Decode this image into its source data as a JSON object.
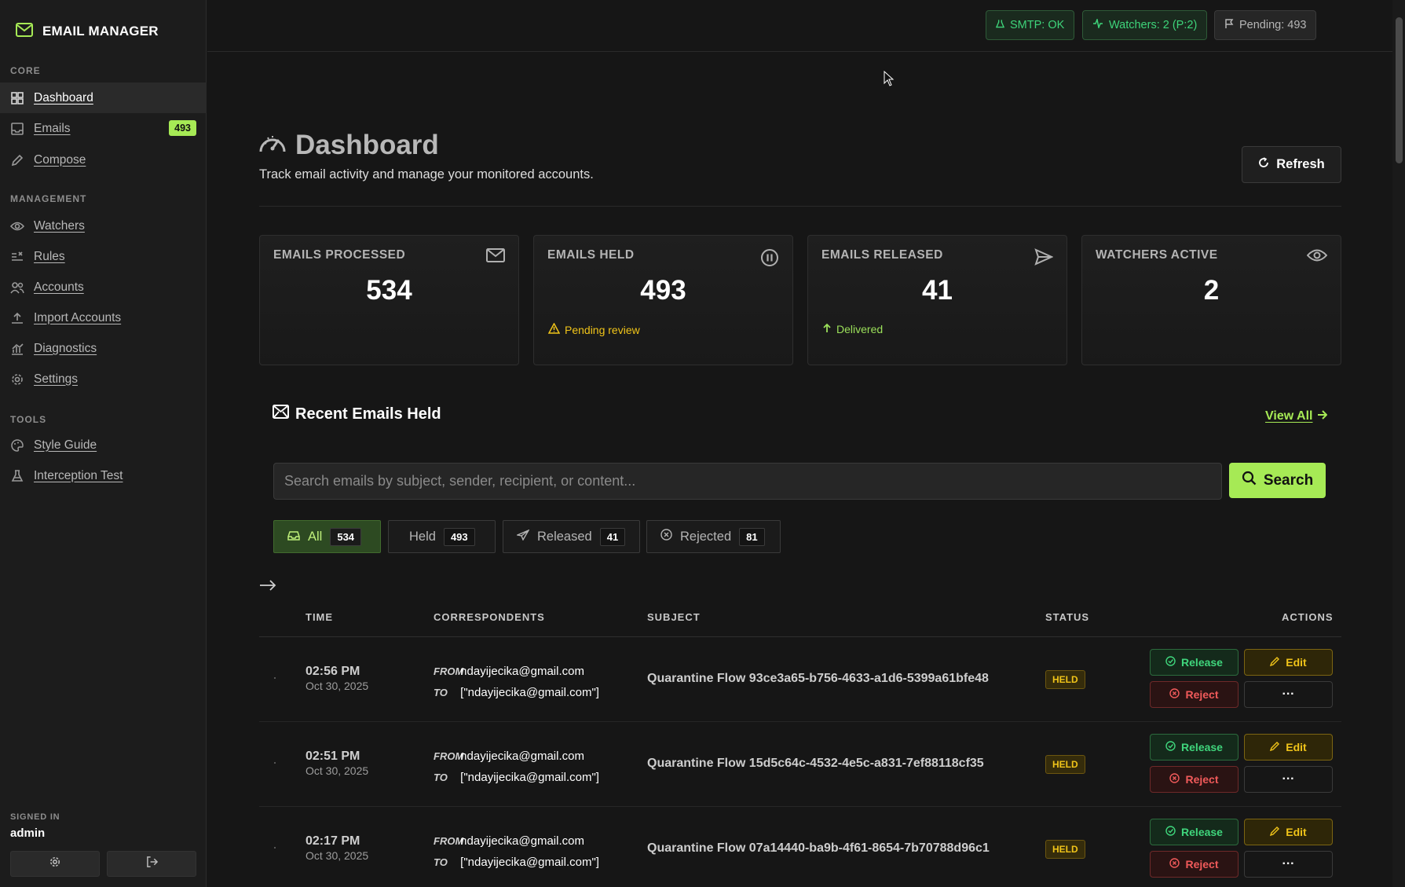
{
  "brand": {
    "name": "EMAIL MANAGER"
  },
  "sidebar": {
    "sections": [
      "CORE",
      "MANAGEMENT",
      "TOOLS"
    ],
    "items": [
      {
        "label": "Dashboard",
        "icon": "grid-icon",
        "active": true
      },
      {
        "label": "Emails",
        "icon": "inbox-icon",
        "badge": "493"
      },
      {
        "label": "Compose",
        "icon": "pencil-icon"
      },
      {
        "label": "Watchers",
        "icon": "eye-icon"
      },
      {
        "label": "Rules",
        "icon": "rules-icon"
      },
      {
        "label": "Accounts",
        "icon": "users-icon"
      },
      {
        "label": "Import Accounts",
        "icon": "upload-icon"
      },
      {
        "label": "Diagnostics",
        "icon": "chart-icon"
      },
      {
        "label": "Settings",
        "icon": "gear-icon"
      },
      {
        "label": "Style Guide",
        "icon": "palette-icon"
      },
      {
        "label": "Interception Test",
        "icon": "flask-icon"
      }
    ],
    "signed_in_label": "SIGNED IN",
    "user": "admin"
  },
  "topbar": {
    "smtp": "SMTP: OK",
    "watchers": "Watchers: 2 (P:2)",
    "pending": "Pending: 493"
  },
  "page": {
    "title": "Dashboard",
    "subtitle": "Track email activity and manage your monitored accounts.",
    "refresh_label": "Refresh"
  },
  "stats": [
    {
      "label": "EMAILS PROCESSED",
      "value": "534",
      "icon": "mail-icon",
      "note": ""
    },
    {
      "label": "EMAILS HELD",
      "value": "493",
      "icon": "pause-icon",
      "note": "Pending review"
    },
    {
      "label": "EMAILS RELEASED",
      "value": "41",
      "icon": "send-icon",
      "note": "Delivered"
    },
    {
      "label": "WATCHERS ACTIVE",
      "value": "2",
      "icon": "eye-icon",
      "note": ""
    }
  ],
  "recent": {
    "title": "Recent Emails Held",
    "view_all": "View All",
    "search_placeholder": "Search emails by subject, sender, recipient, or content...",
    "search_value": "",
    "search_button": "Search",
    "filters": [
      {
        "label": "All",
        "count": "534",
        "active": true
      },
      {
        "label": "Held",
        "count": "493"
      },
      {
        "label": "Released",
        "count": "41"
      },
      {
        "label": "Rejected",
        "count": "81"
      }
    ],
    "columns": [
      "TIME",
      "CORRESPONDENTS",
      "SUBJECT",
      "STATUS",
      "ACTIONS"
    ],
    "from_label": "FROM",
    "to_label": "TO",
    "actions": {
      "release": "Release",
      "edit": "Edit",
      "reject": "Reject",
      "more": "···"
    },
    "rows": [
      {
        "time": "02:56 PM",
        "date": "Oct 30, 2025",
        "from": "ndayijecika@gmail.com",
        "to": "[\"ndayijecika@gmail.com\"]",
        "subject": "Quarantine Flow 93ce3a65-b756-4633-a1d6-5399a61bfe48",
        "status": "HELD"
      },
      {
        "time": "02:51 PM",
        "date": "Oct 30, 2025",
        "from": "ndayijecika@gmail.com",
        "to": "[\"ndayijecika@gmail.com\"]",
        "subject": "Quarantine Flow 15d5c64c-4532-4e5c-a831-7ef88118cf35",
        "status": "HELD"
      },
      {
        "time": "02:17 PM",
        "date": "Oct 30, 2025",
        "from": "ndayijecika@gmail.com",
        "to": "[\"ndayijecika@gmail.com\"]",
        "subject": "Quarantine Flow 07a14440-ba9b-4f61-8654-7b70788d96c1",
        "status": "HELD"
      }
    ]
  },
  "colors": {
    "accent": "#a6ea55",
    "ok": "#3ed47a",
    "warn": "#f0c419",
    "danger": "#f05a5a"
  }
}
